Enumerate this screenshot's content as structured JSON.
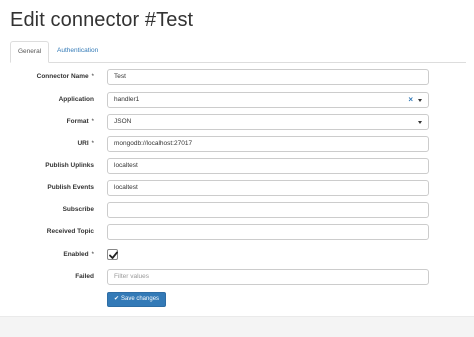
{
  "page": {
    "title": "Edit connector #Test"
  },
  "tabs": [
    {
      "label": "General",
      "active": true
    },
    {
      "label": "Authentication",
      "active": false
    }
  ],
  "form": {
    "connector_name": {
      "label": "Connector Name",
      "required": "*",
      "value": "Test"
    },
    "application": {
      "label": "Application",
      "value": "handler1",
      "clear": "×"
    },
    "format": {
      "label": "Format",
      "required": "*",
      "value": "JSON"
    },
    "uri": {
      "label": "URI",
      "required": "*",
      "value": "mongodb://localhost:27017"
    },
    "publish_uplinks": {
      "label": "Publish Uplinks",
      "value": "localtest"
    },
    "publish_events": {
      "label": "Publish Events",
      "value": "localtest"
    },
    "subscribe": {
      "label": "Subscribe",
      "value": ""
    },
    "received_topic": {
      "label": "Received Topic",
      "value": ""
    },
    "enabled": {
      "label": "Enabled",
      "required": "*",
      "checked": true
    },
    "failed": {
      "label": "Failed",
      "placeholder": "Filter values"
    }
  },
  "actions": {
    "save_label": "Save changes"
  },
  "colors": {
    "primary": "#337ab7",
    "link": "#337ab7",
    "border": "#cccccc"
  }
}
